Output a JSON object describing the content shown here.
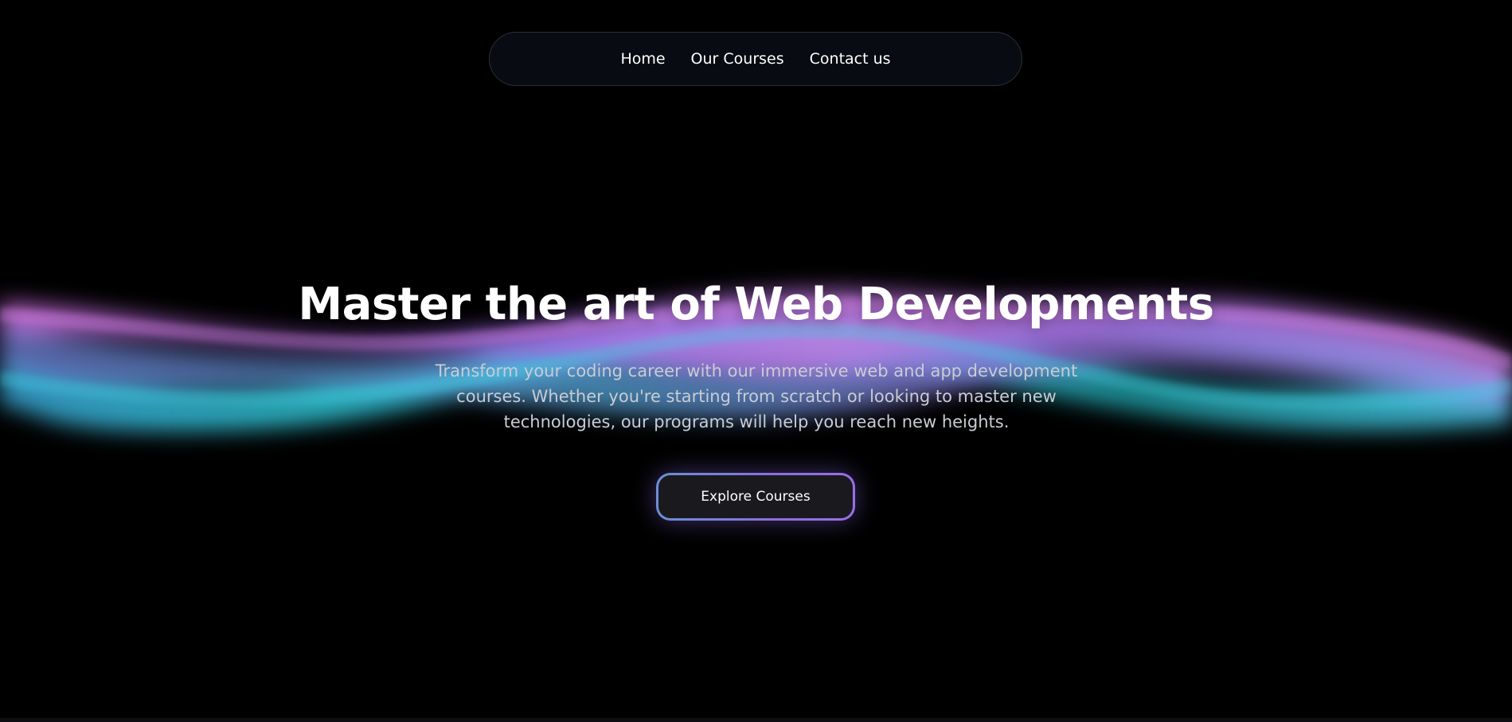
{
  "nav": {
    "items": [
      {
        "label": "Home"
      },
      {
        "label": "Our Courses"
      },
      {
        "label": "Contact us"
      }
    ]
  },
  "hero": {
    "title": "Master the art of Web Developments",
    "subtitle": "Transform your coding career with our immersive web and app development courses. Whether you're starting from scratch or looking to master new technologies, our programs will help you reach new heights.",
    "cta_label": "Explore Courses"
  },
  "colors": {
    "background": "#000000",
    "wave_pink": "#c86fe0",
    "wave_cyan": "#34c6d8",
    "wave_blue": "#6a8ae0",
    "cta_border_start": "#6b8fd6",
    "cta_border_end": "#9b6ee8"
  }
}
